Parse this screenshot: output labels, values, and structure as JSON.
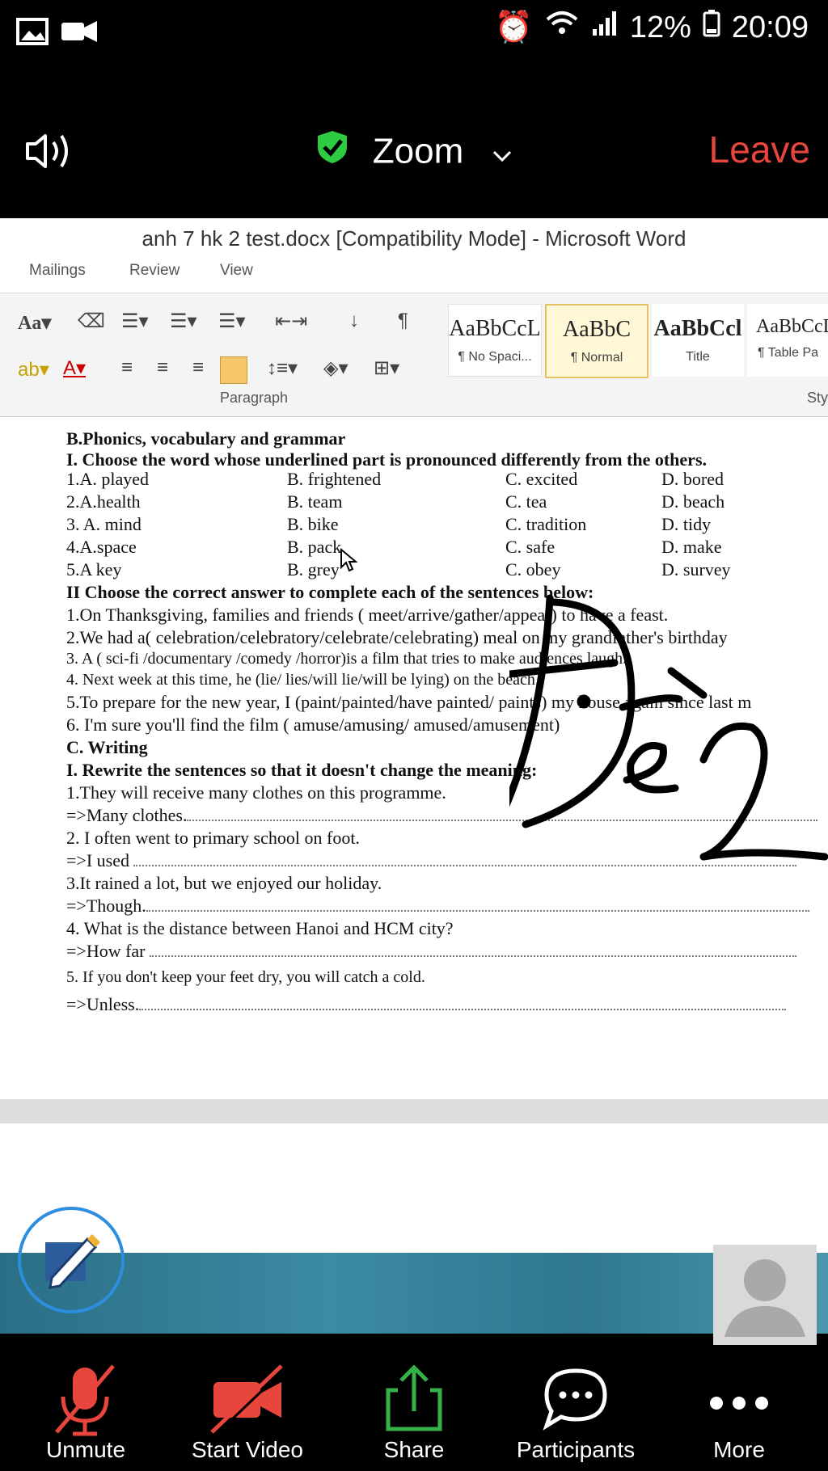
{
  "status_bar": {
    "battery": "12%",
    "time": "20:09"
  },
  "header": {
    "title": "Zoom",
    "leave_label": "Leave"
  },
  "word": {
    "window_title": "anh  7 hk 2 test.docx [Compatibility Mode]  -  Microsoft Word",
    "tabs": [
      "Mailings",
      "Review",
      "View"
    ],
    "ribbon_group": "Paragraph",
    "ribbon_group_cut": "Sty",
    "styles": [
      {
        "preview": "AaBbCcL",
        "name": "¶ No Spaci..."
      },
      {
        "preview": "AaBbC",
        "name": "¶ Normal"
      },
      {
        "preview": "AaBbCcl",
        "name": "Title"
      },
      {
        "preview": "AaBbCcD",
        "name": "¶ Table Pa"
      }
    ]
  },
  "document": {
    "section_b": "B.Phonics, vocabulary and grammar",
    "part1_heading": "I. Choose the word whose underlined part is pronounced differently from the others.",
    "phonics_rows": [
      [
        "1.A. played",
        "B. frightened",
        "C. excited",
        "D. bored"
      ],
      [
        "2.A.health",
        "B. team",
        "C. tea",
        "D. beach"
      ],
      [
        "3. A. mind",
        "B. bike",
        "C. tradition",
        "D. tidy"
      ],
      [
        "4.A.space",
        "B. pack",
        "C. safe",
        "D. make"
      ],
      [
        "5.A key",
        "B. grey",
        "C. obey",
        "D. survey"
      ]
    ],
    "part2_heading": "II Choose the correct answer to complete each of the sentences below:",
    "sentences": [
      "1.On Thanksgiving, families and friends ( meet/arrive/gather/appear) to have a feast.",
      "2.We had a( celebration/celebratory/celebrate/celebrating)  meal on my grandfather's birthday",
      "3. A ( sci-fi /documentary /comedy /horror)is a film that tries to make audiences laugh.",
      "4. Next week at this time, he  (lie/  lies/will  lie/will  be lying) on the beach.",
      "5.To prepare for the new year, I (paint/painted/have painted/ paints) my house again since last m",
      "6. I'm sure you'll find the film ( amuse/amusing/ amused/amusement)"
    ],
    "section_c": "C. Writing",
    "rewrite_heading": "I. Rewrite the sentences so that it doesn't change the meaning:",
    "rewrite": [
      {
        "prompt": "1.They will receive many clothes on this programme.",
        "answer": "=>Many clothes."
      },
      {
        "prompt": "2. I often went to primary school on foot.",
        "answer": " =>I used "
      },
      {
        "prompt": "3.It rained a lot, but we enjoyed our holiday.",
        "answer": "=>Though."
      },
      {
        "prompt": "4. What is the distance between Hanoi and HCM city?",
        "answer": " =>How far "
      },
      {
        "prompt": "5.  If you don't keep your feet dry, you will catch a cold.",
        "answer": "=>Unless."
      }
    ]
  },
  "toolbar": {
    "unmute": "Unmute",
    "start_video": "Start Video",
    "share": "Share",
    "participants": "Participants",
    "more": "More"
  },
  "colors": {
    "leave": "#e8453c",
    "shield": "#2ecc40",
    "mic_off": "#e8453c",
    "share_green": "#35b24a",
    "annotate_ring": "#2d8ee0"
  }
}
